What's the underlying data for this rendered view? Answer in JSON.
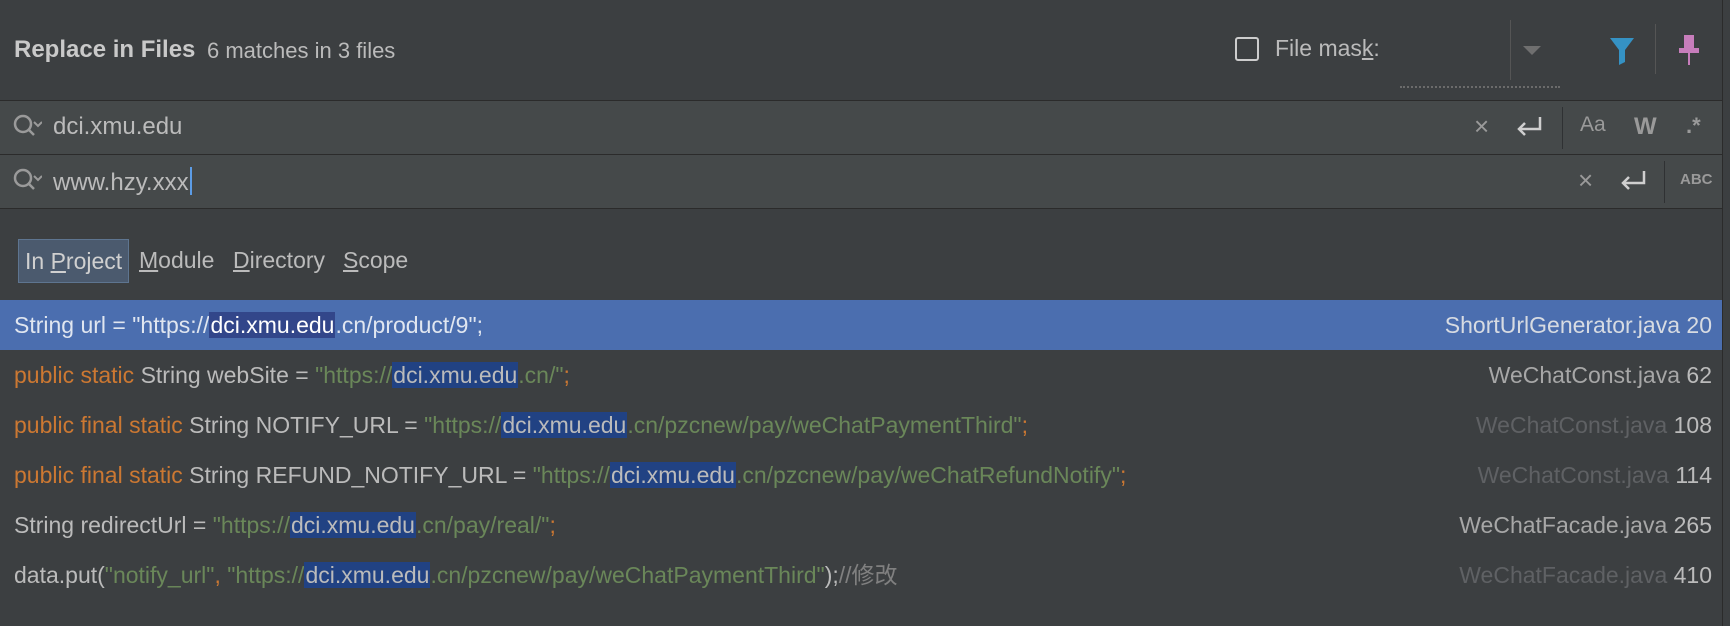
{
  "header": {
    "title": "Replace in Files",
    "matches": "6 matches in 3 files",
    "file_mask_label": "File mask:",
    "file_mask_checked": false,
    "icons": [
      "filter-icon",
      "pin-icon"
    ]
  },
  "search": {
    "value": "dci.xmu.edu",
    "clear_glyph": "×",
    "options": {
      "match_case": "Aa",
      "words": "W",
      "regex": ".*"
    }
  },
  "replace": {
    "value": "www.hzy.xxx",
    "clear_glyph": "×",
    "preserve_case": "ABC"
  },
  "scope_tabs": [
    {
      "label": "In Project",
      "active": true
    },
    {
      "label": "Module",
      "active": false
    },
    {
      "label": "Directory",
      "active": false
    },
    {
      "label": "Scope",
      "active": false
    }
  ],
  "results": [
    {
      "selected": true,
      "file": "ShortUrlGenerator.java",
      "line": "20",
      "parts": [
        {
          "t": "plain",
          "v": "String url = \"https://"
        },
        {
          "t": "hl",
          "v": "dci.xmu.edu"
        },
        {
          "t": "plain",
          "v": ".cn/product/9\";"
        }
      ]
    },
    {
      "selected": false,
      "file": "WeChatConst.java",
      "line": "62",
      "parts": [
        {
          "t": "kw",
          "v": "public static "
        },
        {
          "t": "plain",
          "v": "String webSite = "
        },
        {
          "t": "str",
          "v": "\"https://"
        },
        {
          "t": "hl",
          "v": "dci.xmu.edu"
        },
        {
          "t": "str",
          "v": ".cn/\""
        },
        {
          "t": "kw",
          "v": ";"
        }
      ]
    },
    {
      "selected": false,
      "dim": true,
      "file": "WeChatConst.java",
      "line": "108",
      "parts": [
        {
          "t": "kw",
          "v": "public final static "
        },
        {
          "t": "plain",
          "v": "String NOTIFY_URL = "
        },
        {
          "t": "str",
          "v": "\"https://"
        },
        {
          "t": "hl",
          "v": "dci.xmu.edu"
        },
        {
          "t": "str",
          "v": ".cn/pzcnew/pay/weChatPaymentThird\""
        },
        {
          "t": "kw",
          "v": ";"
        }
      ]
    },
    {
      "selected": false,
      "dim": true,
      "file": "WeChatConst.java",
      "line": "114",
      "parts": [
        {
          "t": "kw",
          "v": "public final static "
        },
        {
          "t": "plain",
          "v": "String REFUND_NOTIFY_URL = "
        },
        {
          "t": "str",
          "v": "\"https://"
        },
        {
          "t": "hl",
          "v": "dci.xmu.edu"
        },
        {
          "t": "str",
          "v": ".cn/pzcnew/pay/weChatRefundNotify\""
        },
        {
          "t": "kw",
          "v": ";"
        }
      ]
    },
    {
      "selected": false,
      "file": "WeChatFacade.java",
      "line": "265",
      "parts": [
        {
          "t": "plain",
          "v": "String redirectUrl = "
        },
        {
          "t": "str",
          "v": "\"https://"
        },
        {
          "t": "hl",
          "v": "dci.xmu.edu"
        },
        {
          "t": "str",
          "v": ".cn/pay/real/\""
        },
        {
          "t": "kw",
          "v": ";"
        }
      ]
    },
    {
      "selected": false,
      "dim": true,
      "file": "WeChatFacade.java",
      "line": "410",
      "parts": [
        {
          "t": "plain",
          "v": "data.put("
        },
        {
          "t": "str",
          "v": "\"notify_url\""
        },
        {
          "t": "kw",
          "v": ", "
        },
        {
          "t": "str",
          "v": "\"https://"
        },
        {
          "t": "hl",
          "v": "dci.xmu.edu"
        },
        {
          "t": "str",
          "v": ".cn/pzcnew/pay/weChatPaymentThird\""
        },
        {
          "t": "plain",
          "v": ");"
        },
        {
          "t": "cmt",
          "v": "//修改"
        }
      ]
    }
  ],
  "colors": {
    "background": "#3c3f41",
    "field": "#45494a",
    "selection": "#4b6eaf",
    "match_highlight": "#214283",
    "keyword": "#cc7832",
    "string": "#6a8759",
    "filter_icon": "#3592c4",
    "pin_icon": "#c77dbb"
  }
}
